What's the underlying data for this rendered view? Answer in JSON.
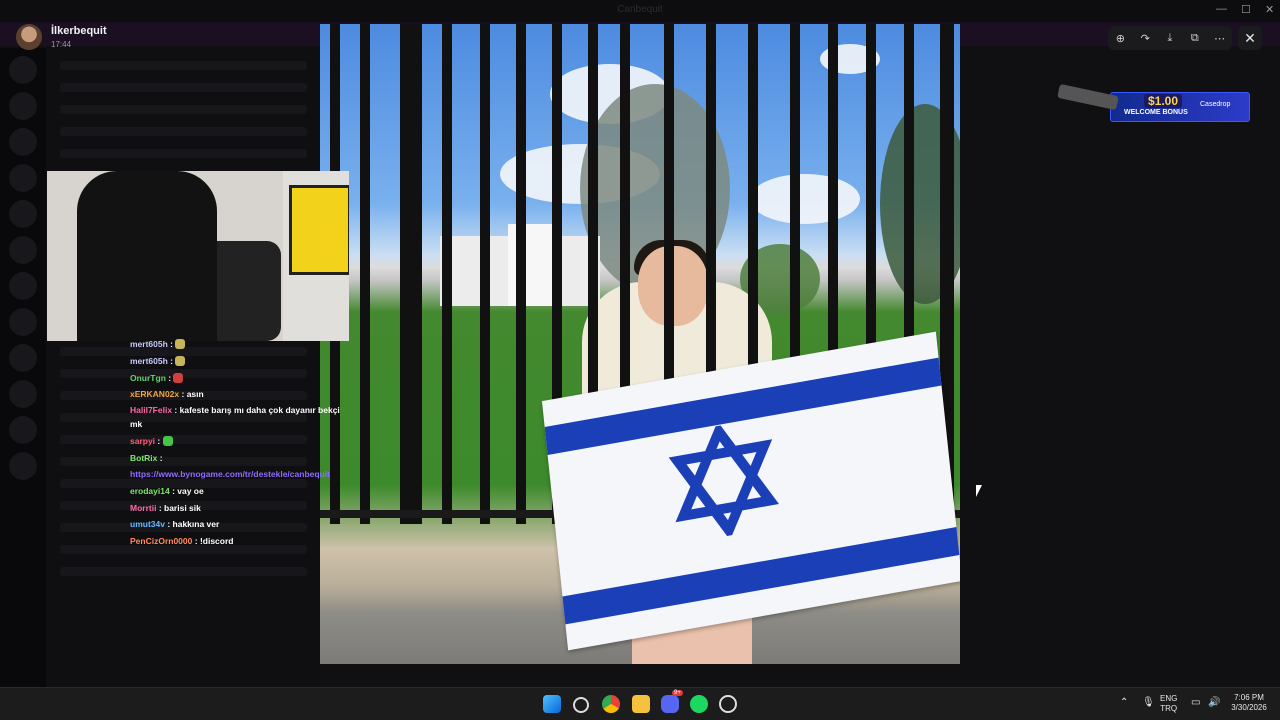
{
  "window": {
    "title": "Canbequit"
  },
  "viewer": {
    "uploader": "İlkerbequit",
    "time": "17:44",
    "toolbar": [
      "zoom-in-icon",
      "forward-icon",
      "download-icon",
      "open-external-icon",
      "more-icon"
    ],
    "close": "✕"
  },
  "ad": {
    "amount": "$1.00",
    "bonus": "WELCOME BONUS",
    "brand": "Casedrop"
  },
  "chat": [
    {
      "user": "mert605h",
      "color": "#c9c9ff",
      "text": "",
      "emote": "#c8b45a"
    },
    {
      "user": "mert605h",
      "color": "#c9c9ff",
      "text": "",
      "emote": "#c8b45a"
    },
    {
      "user": "OnurTgn",
      "color": "#65d46e",
      "text": "",
      "emote": "#d04040"
    },
    {
      "user": "xERKAN02x",
      "color": "#f0a63a",
      "text": "asın"
    },
    {
      "user": "Halil7Felix",
      "color": "#ff6aa6",
      "text": "kafeste barış mı daha çok dayanır bekçi mk"
    },
    {
      "user": "sarpyi",
      "color": "#ff5a7a",
      "text": "",
      "emote": "#46c446"
    },
    {
      "user": "BotRix",
      "color": "#7ee66a",
      "text": ""
    },
    {
      "user": "",
      "color": "#8f6bff",
      "text": "https://www.bynogame.com/tr/destekle/canbequit"
    },
    {
      "user": "erodayi14",
      "color": "#7ee66a",
      "text": "vay oe"
    },
    {
      "user": "Morrtii",
      "color": "#ff6aa6",
      "text": "barisi sik"
    },
    {
      "user": "umut34v",
      "color": "#69b6ff",
      "text": "hakkına ver"
    },
    {
      "user": "PenCizOrn0000",
      "color": "#ff8a5a",
      "text": "!discord"
    }
  ],
  "taskbar": {
    "lang": "ENG",
    "layout": "TRQ",
    "time": "7:06 PM",
    "date": "3/30/2026",
    "discord_badge": "9+"
  }
}
